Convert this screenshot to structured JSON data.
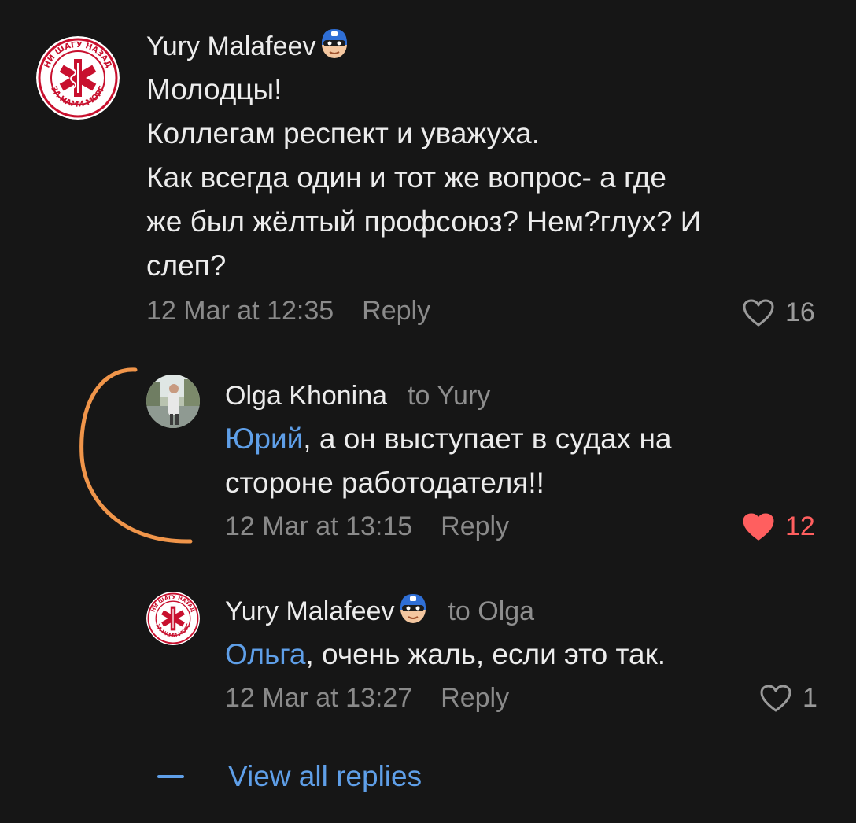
{
  "comments": [
    {
      "author": "Yury Malafeev",
      "author_emoji": "mask-emoji",
      "text_lines": [
        "Молодцы!",
        "Коллегам респект и уважуха.",
        "Как всегда один и тот же вопрос- а где",
        "же был жёлтый профсоюз? Нем?глух? И",
        "слеп?"
      ],
      "timestamp": "12 Mar at 12:35",
      "reply_label": "Reply",
      "likes": "16",
      "liked": false
    },
    {
      "author": "Olga Khonina",
      "reply_to": "to Yury",
      "mention": "Юрий",
      "text_line1_rest": ", а он выступает в судах на",
      "text_line2": "стороне работодателя!!",
      "timestamp": "12 Mar at 13:15",
      "reply_label": "Reply",
      "likes": "12",
      "liked": true
    },
    {
      "author": "Yury Malafeev",
      "reply_to": "to Olga",
      "mention": "Ольга",
      "text_rest": ", очень жаль, если это так.",
      "timestamp": "12 Mar at 13:27",
      "reply_label": "Reply",
      "likes": "1",
      "liked": false
    }
  ],
  "view_all_replies": "View all replies",
  "avatar_logo_text": {
    "top": "НИ ШАГУ НАЗАД",
    "bottom": "ЗА НАМИ МОРГ"
  },
  "colors": {
    "background": "#161616",
    "link": "#5f9fe8",
    "liked_heart": "#ff5f5f",
    "annotation": "#f0954a"
  }
}
